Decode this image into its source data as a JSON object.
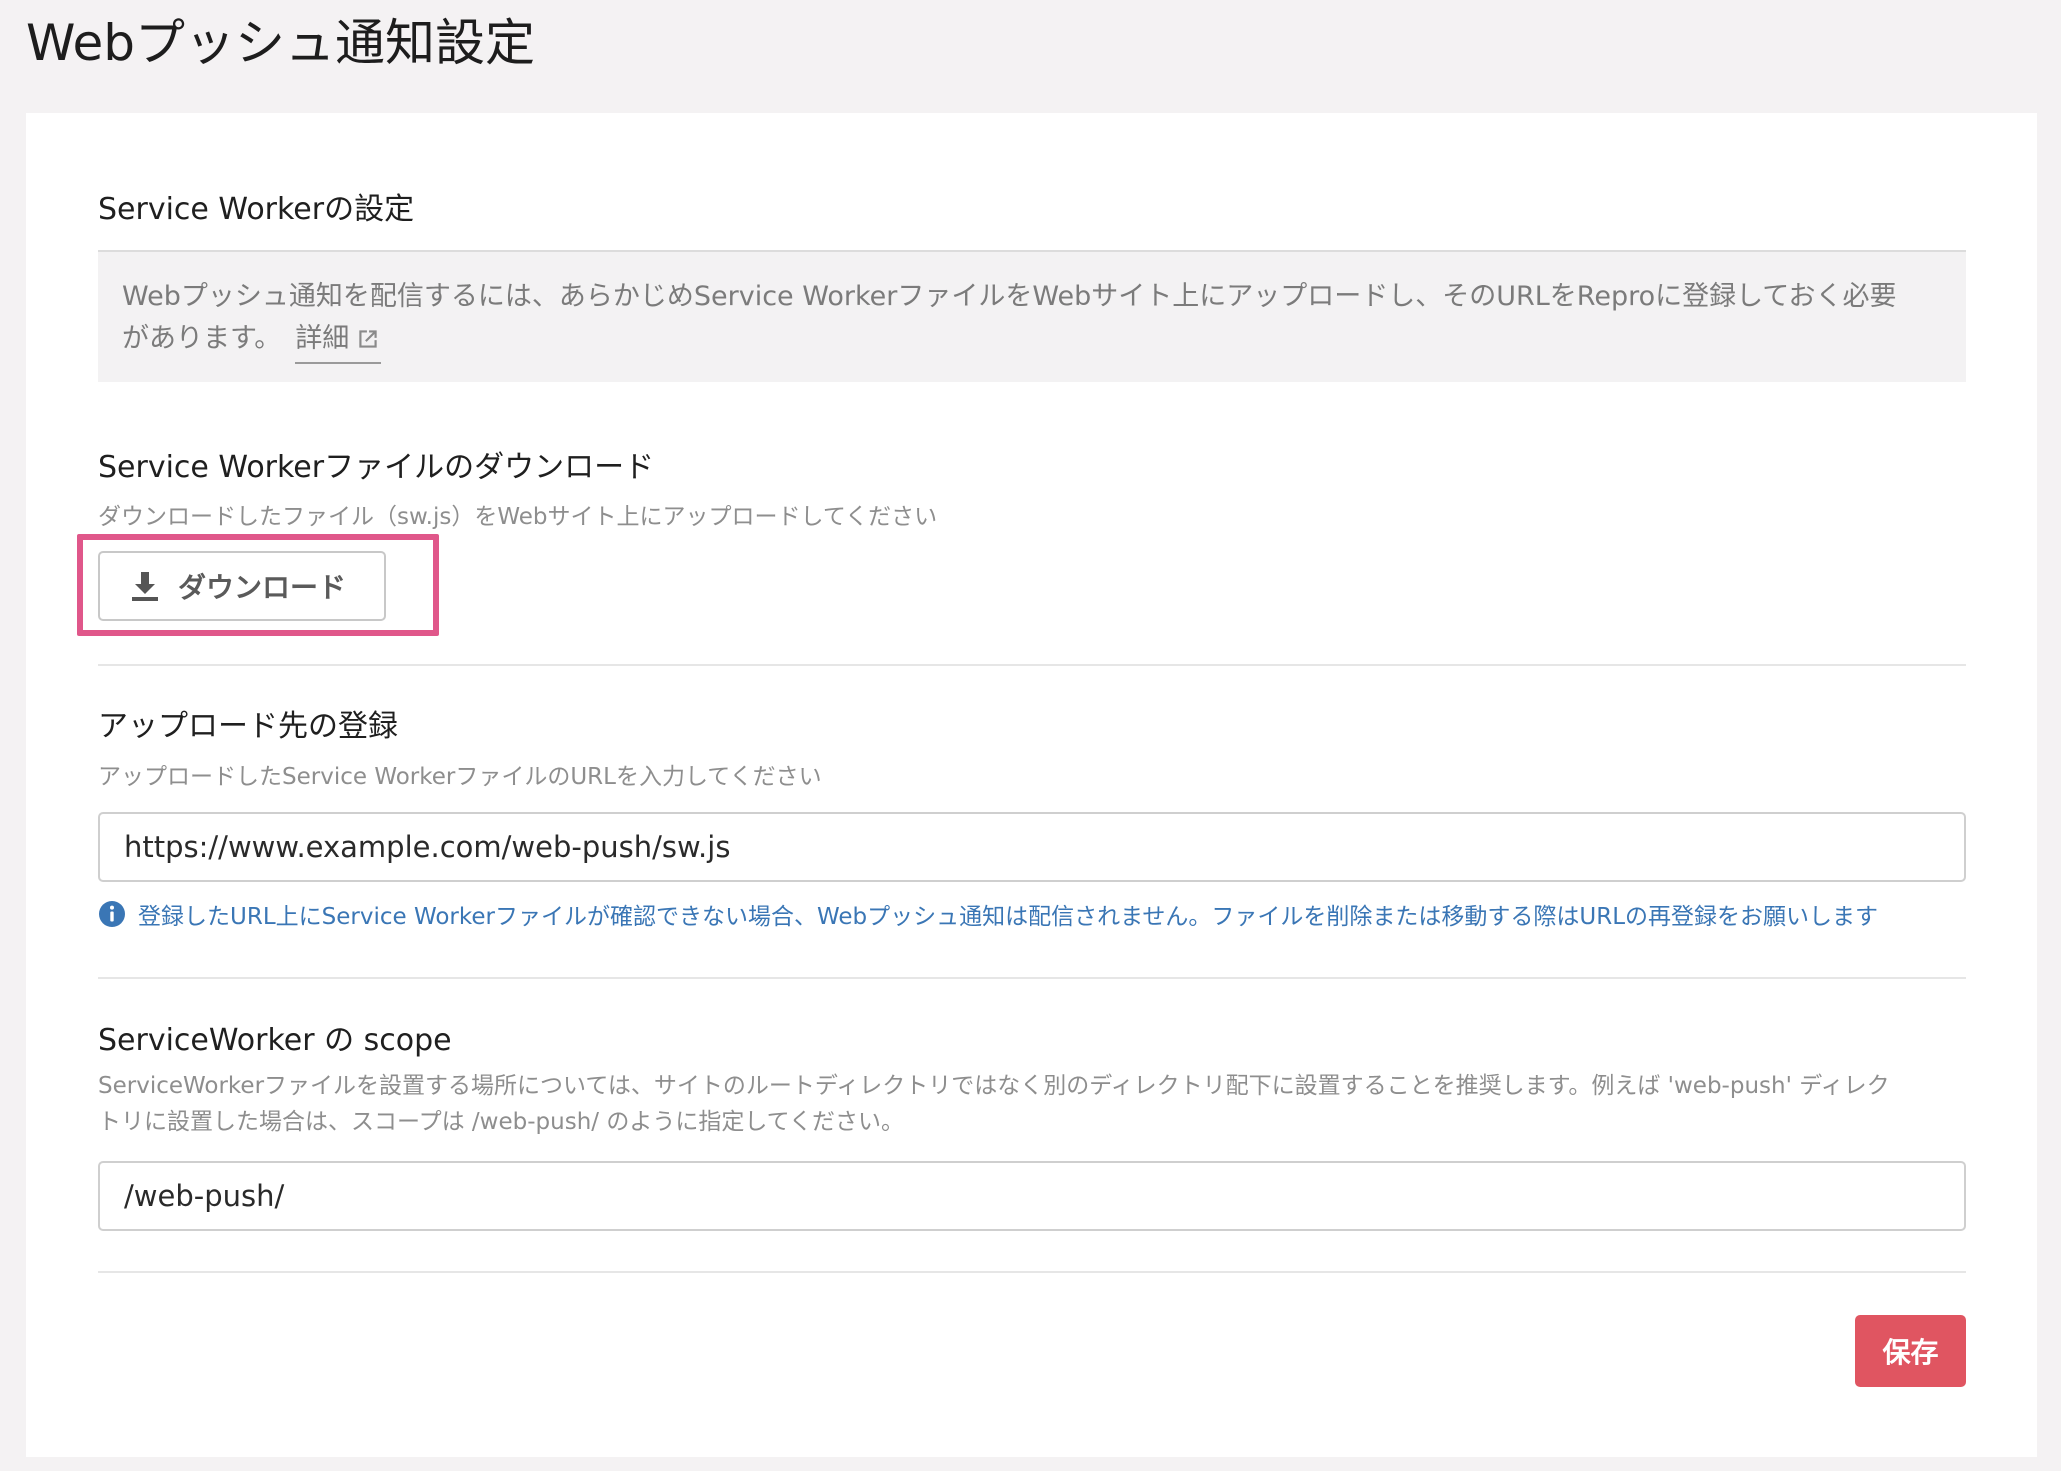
{
  "page": {
    "title": "Webプッシュ通知設定"
  },
  "service_worker": {
    "title": "Service Workerの設定",
    "info_line1": "Webプッシュ通知を配信するには、あらかじめService WorkerファイルをWebサイト上にアップロードし、そのURLをReproに登録しておく必要",
    "info_line2": "があります。",
    "detail_link": "詳細"
  },
  "download": {
    "title": "Service Workerファイルのダウンロード",
    "description": "ダウンロードしたファイル（sw.js）をWebサイト上にアップロードしてください",
    "button_label": "ダウンロード"
  },
  "upload": {
    "title": "アップロード先の登録",
    "description": "アップロードしたService WorkerファイルのURLを入力してください",
    "url_value": "https://www.example.com/web-push/sw.js",
    "notice": "登録したURL上にService Workerファイルが確認できない場合、Webプッシュ通知は配信されません。ファイルを削除または移動する際はURLの再登録をお願いします"
  },
  "scope": {
    "title": "ServiceWorker の scope",
    "desc_line1": "ServiceWorkerファイルを設置する場所については、サイトのルートディレクトリではなく別のディレクトリ配下に設置することを推奨します。例えば 'web-push' ディレク",
    "desc_line2": "トリに設置した場合は、スコープは /web-push/ のように指定してください。",
    "value": "/web-push/"
  },
  "actions": {
    "save_label": "保存"
  },
  "colors": {
    "highlight": "#e0578a",
    "save_button": "#e05561",
    "notice_text": "#3a76b5"
  }
}
